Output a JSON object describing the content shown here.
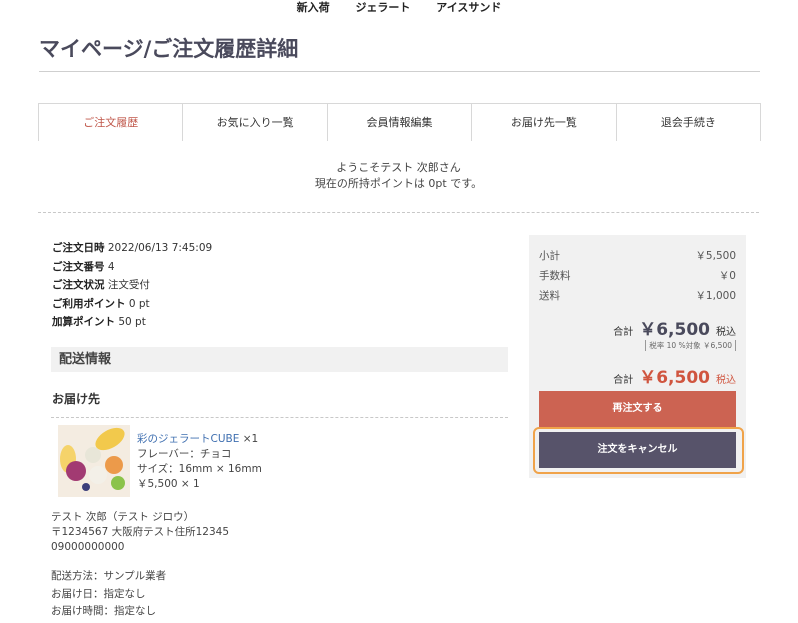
{
  "topnav": [
    "新入荷",
    "ジェラート",
    "アイスサンド"
  ],
  "page_title": "マイページ/ご注文履歴詳細",
  "tabs": [
    "ご注文履歴",
    "お気に入り一覧",
    "会員情報編集",
    "お届け先一覧",
    "退会手続き"
  ],
  "welcome": {
    "line1": "ようこそテスト 次郎さん",
    "line2": "現在の所持ポイントは 0pt です。"
  },
  "order_info": [
    {
      "label": "ご注文日時",
      "value": "2022/06/13 7:45:09"
    },
    {
      "label": "ご注文番号",
      "value": "4"
    },
    {
      "label": "ご注文状況",
      "value": "注文受付"
    },
    {
      "label": "ご利用ポイント",
      "value": "0 pt"
    },
    {
      "label": "加算ポイント",
      "value": "50 pt"
    }
  ],
  "shipping_section_title": "配送情報",
  "destination_label": "お届け先",
  "product": {
    "name": "彩のジェラートCUBE",
    "qty": "×1",
    "flavor": "フレーバー：チョコ",
    "size": "サイズ：16mm × 16mm",
    "price": "￥5,500 × 1"
  },
  "address": {
    "name": "テスト 次郎（テスト ジロウ）",
    "postal": "〒1234567 大阪府テスト住所12345",
    "phone": "09000000000"
  },
  "shipping": {
    "method": "配送方法：サンプル業者",
    "date": "お届け日：指定なし",
    "time": "お届け時間：指定なし"
  },
  "summary": {
    "subtotal_label": "小計",
    "subtotal_value": "￥5,500",
    "fee_label": "手数料",
    "fee_value": "￥0",
    "shipping_label": "送料",
    "shipping_value": "￥1,000",
    "total_label": "合計",
    "total_value": "￥6,500",
    "tax_in": "税込",
    "tax_note": "税率 10 %対象 ￥6,500",
    "payment_label": "合計",
    "payment_value": "￥6,500",
    "payment_tax_in": "税込"
  },
  "buttons": {
    "reorder": "再注文する",
    "cancel": "注文をキャンセル"
  }
}
